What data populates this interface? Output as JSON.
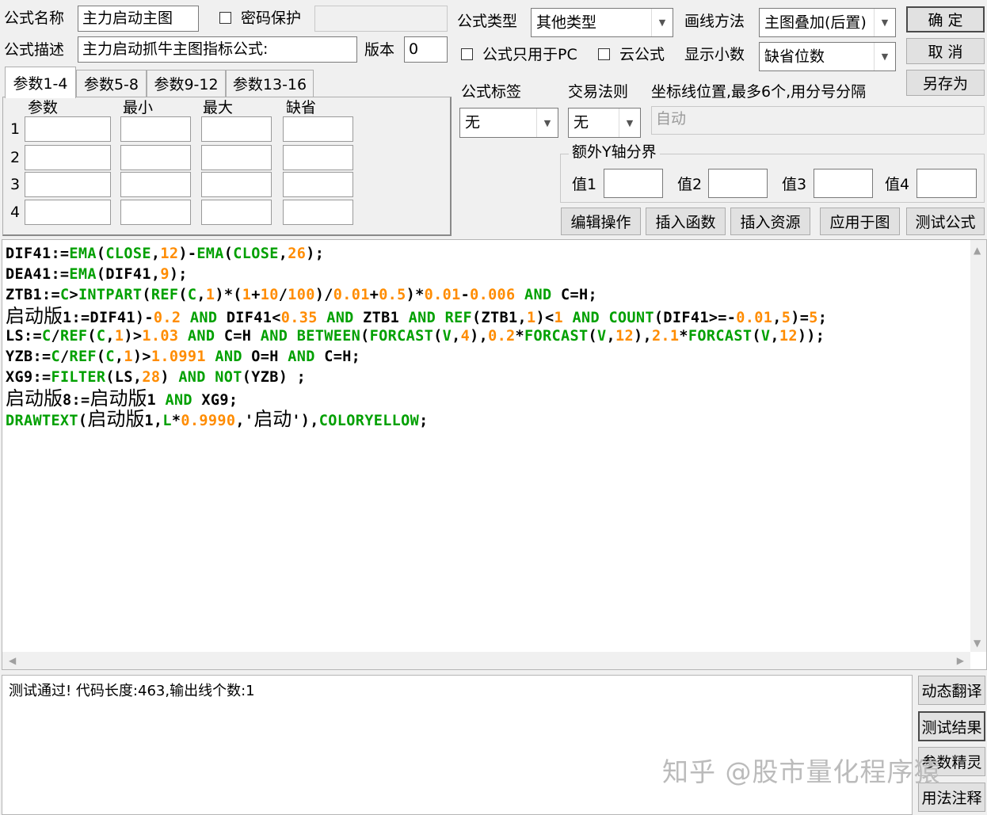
{
  "header": {
    "name_label": "公式名称",
    "name_value": "主力启动主图",
    "password_label": "密码保护",
    "password_checked": false,
    "password_value": "",
    "desc_label": "公式描述",
    "desc_value": "主力启动抓牛主图指标公式:",
    "version_label": "版本",
    "version_value": "0"
  },
  "type_section": {
    "type_label": "公式类型",
    "type_value": "其他类型",
    "draw_label": "画线方法",
    "draw_value": "主图叠加(后置)",
    "pc_only_label": "公式只用于PC",
    "pc_only_checked": false,
    "cloud_label": "云公式",
    "cloud_checked": false,
    "decimal_label": "显示小数",
    "decimal_value": "缺省位数",
    "tag_label": "公式标签",
    "tag_value": "无",
    "rule_label": "交易法则",
    "rule_value": "无",
    "coord_label": "坐标线位置,最多6个,用分号分隔",
    "coord_placeholder": "自动",
    "extra_y_label": "额外Y轴分界",
    "values": [
      {
        "label": "值1",
        "value": ""
      },
      {
        "label": "值2",
        "value": ""
      },
      {
        "label": "值3",
        "value": ""
      },
      {
        "label": "值4",
        "value": ""
      }
    ]
  },
  "buttons": {
    "ok": "确  定",
    "cancel": "取  消",
    "save_as": "另存为",
    "edit_op": "编辑操作",
    "insert_func": "插入函数",
    "insert_res": "插入资源",
    "apply_chart": "应用于图",
    "test_formula": "测试公式"
  },
  "params": {
    "tabs": [
      "参数1-4",
      "参数5-8",
      "参数9-12",
      "参数13-16"
    ],
    "active_tab": 0,
    "headers": [
      "参数",
      "最小",
      "最大",
      "缺省"
    ],
    "rows": [
      {
        "index": "1",
        "cells": [
          "",
          "",
          "",
          ""
        ]
      },
      {
        "index": "2",
        "cells": [
          "",
          "",
          "",
          ""
        ]
      },
      {
        "index": "3",
        "cells": [
          "",
          "",
          "",
          ""
        ]
      },
      {
        "index": "4",
        "cells": [
          "",
          "",
          "",
          ""
        ]
      }
    ]
  },
  "code": {
    "lines": [
      [
        [
          "t",
          "DIF41:="
        ],
        [
          "k",
          "EMA"
        ],
        [
          "t",
          "("
        ],
        [
          "k",
          "CLOSE"
        ],
        [
          "t",
          ","
        ],
        [
          "n",
          "12"
        ],
        [
          "t",
          ")-"
        ],
        [
          "k",
          "EMA"
        ],
        [
          "t",
          "("
        ],
        [
          "k",
          "CLOSE"
        ],
        [
          "t",
          ","
        ],
        [
          "n",
          "26"
        ],
        [
          "t",
          ");"
        ]
      ],
      [
        [
          "t",
          "DEA41:="
        ],
        [
          "k",
          "EMA"
        ],
        [
          "t",
          "(DIF41,"
        ],
        [
          "n",
          "9"
        ],
        [
          "t",
          ");"
        ]
      ],
      [
        [
          "t",
          "ZTB1:="
        ],
        [
          "k",
          "C"
        ],
        [
          "t",
          ">"
        ],
        [
          "k",
          "INTPART"
        ],
        [
          "t",
          "("
        ],
        [
          "k",
          "REF"
        ],
        [
          "t",
          "("
        ],
        [
          "k",
          "C"
        ],
        [
          "t",
          ","
        ],
        [
          "n",
          "1"
        ],
        [
          "t",
          ")*("
        ],
        [
          "n",
          "1"
        ],
        [
          "t",
          "+"
        ],
        [
          "n",
          "10"
        ],
        [
          "t",
          "/"
        ],
        [
          "n",
          "100"
        ],
        [
          "t",
          ")/"
        ],
        [
          "n",
          "0.01"
        ],
        [
          "t",
          "+"
        ],
        [
          "n",
          "0.5"
        ],
        [
          "t",
          ")*"
        ],
        [
          "n",
          "0.01"
        ],
        [
          "t",
          "-"
        ],
        [
          "n",
          "0.006"
        ],
        [
          "t",
          " "
        ],
        [
          "k",
          "AND"
        ],
        [
          "t",
          " C=H;"
        ]
      ],
      [
        [
          "c",
          "启动版"
        ],
        [
          "t",
          "1:=DIF41)-"
        ],
        [
          "n",
          "0.2"
        ],
        [
          "t",
          " "
        ],
        [
          "k",
          "AND"
        ],
        [
          "t",
          " DIF41<"
        ],
        [
          "n",
          "0.35"
        ],
        [
          "t",
          " "
        ],
        [
          "k",
          "AND"
        ],
        [
          "t",
          " ZTB1 "
        ],
        [
          "k",
          "AND"
        ],
        [
          "t",
          " "
        ],
        [
          "k",
          "REF"
        ],
        [
          "t",
          "(ZTB1,"
        ],
        [
          "n",
          "1"
        ],
        [
          "t",
          ")<"
        ],
        [
          "n",
          "1"
        ],
        [
          "t",
          " "
        ],
        [
          "k",
          "AND"
        ],
        [
          "t",
          " "
        ],
        [
          "k",
          "COUNT"
        ],
        [
          "t",
          "(DIF41>=-"
        ],
        [
          "n",
          "0.01"
        ],
        [
          "t",
          ","
        ],
        [
          "n",
          "5"
        ],
        [
          "t",
          ")="
        ],
        [
          "n",
          "5"
        ],
        [
          "t",
          ";"
        ]
      ],
      [
        [
          "t",
          "LS:="
        ],
        [
          "k",
          "C"
        ],
        [
          "t",
          "/"
        ],
        [
          "k",
          "REF"
        ],
        [
          "t",
          "("
        ],
        [
          "k",
          "C"
        ],
        [
          "t",
          ","
        ],
        [
          "n",
          "1"
        ],
        [
          "t",
          ")>"
        ],
        [
          "n",
          "1.03"
        ],
        [
          "t",
          " "
        ],
        [
          "k",
          "AND"
        ],
        [
          "t",
          " C=H "
        ],
        [
          "k",
          "AND"
        ],
        [
          "t",
          " "
        ],
        [
          "k",
          "BETWEEN"
        ],
        [
          "t",
          "("
        ],
        [
          "k",
          "FORCAST"
        ],
        [
          "t",
          "("
        ],
        [
          "k",
          "V"
        ],
        [
          "t",
          ","
        ],
        [
          "n",
          "4"
        ],
        [
          "t",
          "),"
        ],
        [
          "n",
          "0.2"
        ],
        [
          "t",
          "*"
        ],
        [
          "k",
          "FORCAST"
        ],
        [
          "t",
          "("
        ],
        [
          "k",
          "V"
        ],
        [
          "t",
          ","
        ],
        [
          "n",
          "12"
        ],
        [
          "t",
          "),"
        ],
        [
          "n",
          "2.1"
        ],
        [
          "t",
          "*"
        ],
        [
          "k",
          "FORCAST"
        ],
        [
          "t",
          "("
        ],
        [
          "k",
          "V"
        ],
        [
          "t",
          ","
        ],
        [
          "n",
          "12"
        ],
        [
          "t",
          "));"
        ]
      ],
      [
        [
          "t",
          "YZB:="
        ],
        [
          "k",
          "C"
        ],
        [
          "t",
          "/"
        ],
        [
          "k",
          "REF"
        ],
        [
          "t",
          "("
        ],
        [
          "k",
          "C"
        ],
        [
          "t",
          ","
        ],
        [
          "n",
          "1"
        ],
        [
          "t",
          ")>"
        ],
        [
          "n",
          "1.0991"
        ],
        [
          "t",
          " "
        ],
        [
          "k",
          "AND"
        ],
        [
          "t",
          " O=H "
        ],
        [
          "k",
          "AND"
        ],
        [
          "t",
          " C=H;"
        ]
      ],
      [
        [
          "t",
          "XG9:="
        ],
        [
          "k",
          "FILTER"
        ],
        [
          "t",
          "(LS,"
        ],
        [
          "n",
          "28"
        ],
        [
          "t",
          ") "
        ],
        [
          "k",
          "AND"
        ],
        [
          "t",
          " "
        ],
        [
          "k",
          "NOT"
        ],
        [
          "t",
          "(YZB) ;"
        ]
      ],
      [
        [
          "c",
          "启动版"
        ],
        [
          "t",
          "8:="
        ],
        [
          "c",
          "启动版"
        ],
        [
          "t",
          "1 "
        ],
        [
          "k",
          "AND"
        ],
        [
          "t",
          " XG9;"
        ]
      ],
      [
        [
          "k",
          "DRAWTEXT"
        ],
        [
          "t",
          "("
        ],
        [
          "c",
          "启动版"
        ],
        [
          "t",
          "1,"
        ],
        [
          "k",
          "L"
        ],
        [
          "t",
          "*"
        ],
        [
          "n",
          "0.9990"
        ],
        [
          "t",
          ",'"
        ],
        [
          "c",
          "启动"
        ],
        [
          "t",
          "'),"
        ],
        [
          "k",
          "COLORYELLOW"
        ],
        [
          "t",
          ";"
        ]
      ]
    ]
  },
  "result": {
    "message": "测试通过! 代码长度:463,输出线个数:1"
  },
  "side_buttons": {
    "dynamic_translate": "动态翻译",
    "test_result": "测试结果",
    "param_wizard": "参数精灵",
    "usage_notes": "用法注释"
  },
  "watermark": "知乎 @股市量化程序猿",
  "colors": {
    "keyword": "#00a000",
    "number": "#ff8c00",
    "text": "#000000",
    "window_bg": "#f0f0f0"
  }
}
